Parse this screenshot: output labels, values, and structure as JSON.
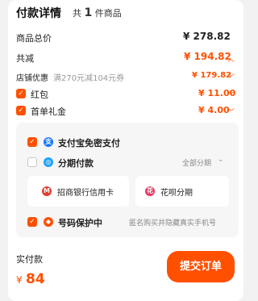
{
  "header": {
    "title": "付款详情",
    "count_prefix": "共",
    "count_num": "1",
    "count_suffix": "件商品"
  },
  "rows": {
    "total": {
      "label": "商品总价",
      "value": "¥ 278.82"
    },
    "reduce": {
      "label": "共减",
      "value": "¥ 194.82"
    },
    "store": {
      "label": "店铺优惠",
      "note": "满270元减104元券",
      "value": "¥ 179.82"
    },
    "hongbao": {
      "label": "红包",
      "value": "¥ 11.00",
      "checked": true
    },
    "firstgift": {
      "label": "首单礼金",
      "value": "¥ 4.00",
      "checked": true
    }
  },
  "payment": {
    "alipay": {
      "label": "支付宝免密支付",
      "icon": "alipay-icon",
      "checked": true
    },
    "installment": {
      "label": "分期付款",
      "right": "全部分期",
      "icon": "installment-icon",
      "checked": false
    },
    "options": [
      {
        "label": "招商银行信用卡",
        "icon": "cmb-bank-icon"
      },
      {
        "label": "花呗分期",
        "icon": "huabei-icon"
      }
    ],
    "protect": {
      "label": "号码保护中",
      "right": "匿名购买并隐藏真实手机号",
      "icon": "shield-icon",
      "checked": true
    }
  },
  "footer": {
    "paid_label": "实付款",
    "currency": "¥",
    "amount": "84",
    "submit_label": "提交订单"
  },
  "colors": {
    "accent": "#ff5000",
    "alipay": "#1677ff"
  }
}
